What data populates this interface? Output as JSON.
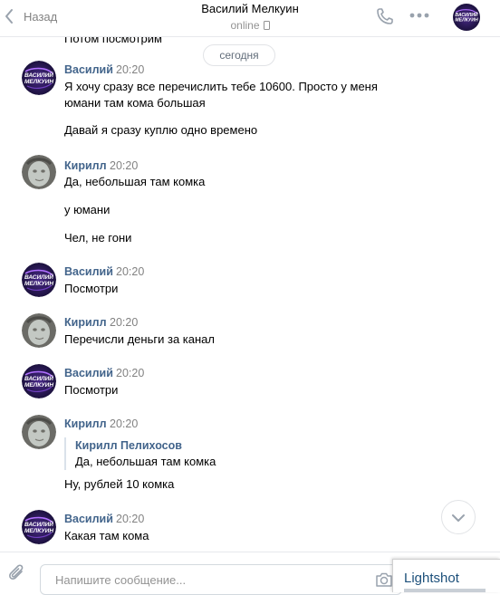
{
  "header": {
    "back_label": "Назад",
    "title": "Василий Мелкуин",
    "status": "online"
  },
  "feed": {
    "cut_text": "Потом посмотрим",
    "date_divider": "сегодня",
    "messages": [
      {
        "author": "Василий",
        "time": "20:20",
        "lines": [
          "Я хочу сразу все перечислить тебе 10600. Просто у меня",
          "юмани там кома большая",
          "Давай я сразу куплю одно времено"
        ]
      },
      {
        "author": "Кирилл",
        "time": "20:20",
        "lines": [
          "Да, небольшая там комка",
          "у юмани",
          "Чел, не гони"
        ]
      },
      {
        "author": "Василий",
        "time": "20:20",
        "lines": [
          "Посмотри"
        ]
      },
      {
        "author": "Кирилл",
        "time": "20:20",
        "lines": [
          "Перечисли деньги за канал"
        ]
      },
      {
        "author": "Василий",
        "time": "20:20",
        "lines": [
          "Посмотри"
        ]
      },
      {
        "author": "Кирилл",
        "time": "20:20",
        "quote_author": "Кирилл Пелихосов",
        "quote_text": "Да, небольшая там комка",
        "lines": [
          "Ну, рублей 10 комка"
        ]
      },
      {
        "author": "Василий",
        "time": "20:20",
        "lines": [
          "Какая там кома"
        ]
      }
    ]
  },
  "avatar_text": {
    "line1": "ВАСИЛИЙ",
    "line2": "МЕЛКУИН"
  },
  "composer": {
    "placeholder": "Напишите сообщение..."
  },
  "overlay": {
    "lightshot_title": "Lightshot"
  },
  "colors": {
    "link": "#42648b",
    "accent": "#2a5885",
    "muted": "#828282"
  }
}
